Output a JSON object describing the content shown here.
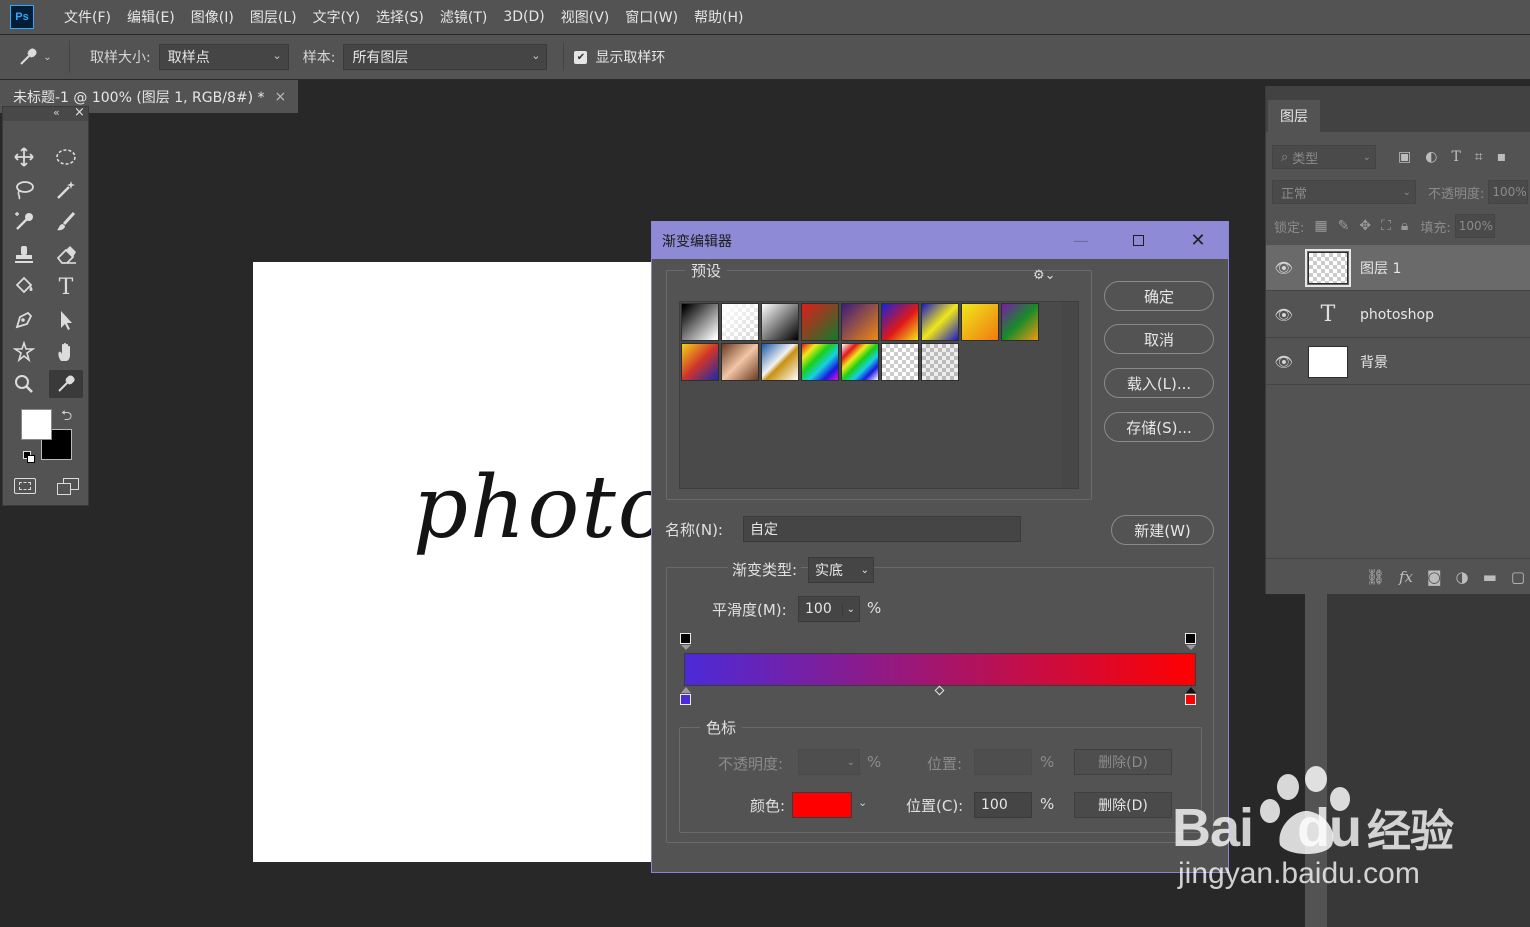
{
  "app": {
    "logo": "Ps",
    "menu": [
      "文件(F)",
      "编辑(E)",
      "图像(I)",
      "图层(L)",
      "文字(Y)",
      "选择(S)",
      "滤镜(T)",
      "3D(D)",
      "视图(V)",
      "窗口(W)",
      "帮助(H)"
    ]
  },
  "options": {
    "sample_size_label": "取样大小:",
    "sample_size_value": "取样点",
    "sample_label": "样本:",
    "sample_value": "所有图层",
    "show_ring_label": "显示取样环",
    "show_ring_checked": true
  },
  "document": {
    "tab_title": "未标题-1 @ 100% (图层 1, RGB/8#) *",
    "close": "×",
    "canvas_text": "photo"
  },
  "toolbox": {
    "collapse": "«",
    "close": "×",
    "tools": [
      "move-icon",
      "marquee-icon",
      "lasso-icon",
      "magic-wand-icon",
      "spot-heal-icon",
      "brush-icon",
      "stamp-icon",
      "eraser-icon",
      "paint-bucket-icon",
      "type-icon",
      "pen-icon",
      "path-select-icon",
      "shape-icon",
      "hand-icon",
      "zoom-icon",
      "eyedropper-icon"
    ],
    "type_tool": "T",
    "foreground_color": "#ffffff",
    "background_color": "#000000"
  },
  "layers_panel": {
    "tab": "图层",
    "filter_placeholder": "类型",
    "blend_mode": "正常",
    "opacity_label": "不透明度:",
    "opacity_value": "100%",
    "lock_label": "锁定:",
    "fill_label": "填充:",
    "fill_value": "100%",
    "layers": [
      {
        "name": "图层 1",
        "type": "raster",
        "selected": true
      },
      {
        "name": "photoshop",
        "type": "text",
        "selected": false
      },
      {
        "name": "背景",
        "type": "background",
        "selected": false
      }
    ],
    "type_glyph": "T"
  },
  "gradient_editor": {
    "title": "渐变编辑器",
    "presets_label": "预设",
    "buttons": {
      "ok": "确定",
      "cancel": "取消",
      "load": "载入(L)...",
      "save": "存储(S)...",
      "new": "新建(W)"
    },
    "name_label": "名称(N):",
    "name_value": "自定",
    "gradient_type_label": "渐变类型:",
    "gradient_type_value": "实底",
    "smoothness_label": "平滑度(M):",
    "smoothness_value": "100",
    "percent": "%",
    "gradient_start_color": "#4b2ad8",
    "gradient_end_color": "#ff0000",
    "stops_label": "色标",
    "opacity_label": "不透明度:",
    "location_label": "位置:",
    "delete_label": "删除(D)",
    "color_label": "颜色:",
    "color_value": "#ff0000",
    "location_c_label": "位置(C):",
    "location_c_value": "100"
  },
  "watermark": {
    "brand": "Bai",
    "brand_du": "du",
    "suffix": "经验",
    "url": "jingyan.baidu.com"
  }
}
